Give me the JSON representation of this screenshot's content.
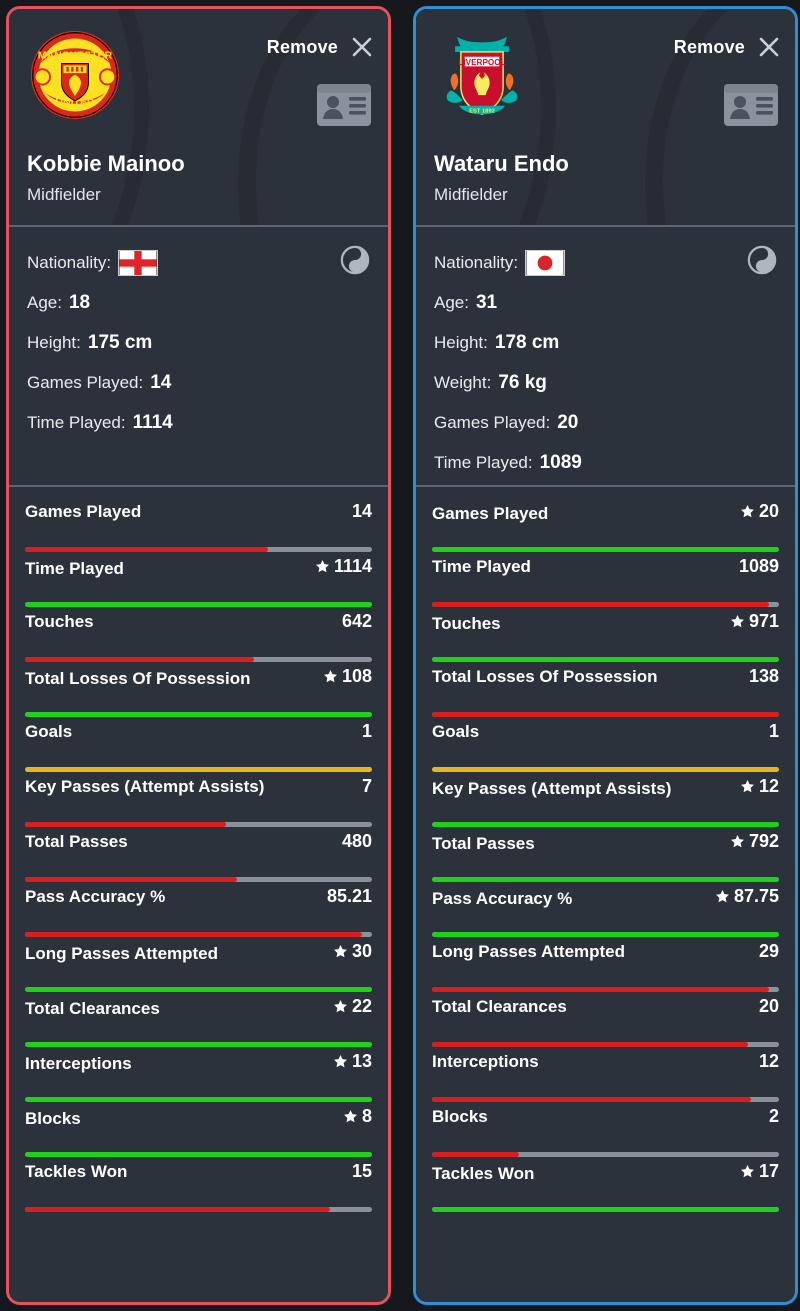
{
  "colors": {
    "accent_left": "#e8505b",
    "accent_right": "#2e8fd4",
    "bar_red": "#d81e1e",
    "bar_green": "#1fd219",
    "bar_yellow": "#e8b51c",
    "bar_track": "#8b919b",
    "card_bg": "#2c323c",
    "page_bg": "#15181d"
  },
  "cards": [
    {
      "accent": "#e8505b",
      "crest": "manchester-united-crest",
      "remove_label": "Remove",
      "close_icon": "close-icon",
      "idcard_icon": "id-card-icon",
      "name": "Kobbie Mainoo",
      "position": "Midfielder",
      "yin_icon": "yin-yang-icon",
      "info": [
        {
          "label": "Nationality:",
          "value": "",
          "flag": "england-flag"
        },
        {
          "label": "Age:",
          "value": "18"
        },
        {
          "label": "Height:",
          "value": "175 cm"
        },
        {
          "label": "Games Played:",
          "value": "14"
        },
        {
          "label": "Time Played:",
          "value": "1114"
        }
      ],
      "stats": [
        {
          "name": "Games Played",
          "value": "14",
          "star": false,
          "pct": 70,
          "color": "#d81e1e"
        },
        {
          "name": "Time Played",
          "value": "1114",
          "star": true,
          "pct": 100,
          "color": "#1fd219"
        },
        {
          "name": "Touches",
          "value": "642",
          "star": false,
          "pct": 66,
          "color": "#d81e1e"
        },
        {
          "name": "Total Losses Of Possession",
          "value": "108",
          "star": true,
          "pct": 100,
          "color": "#1fd219"
        },
        {
          "name": "Goals",
          "value": "1",
          "star": false,
          "pct": 100,
          "color": "#e8b51c"
        },
        {
          "name": "Key Passes (Attempt Assists)",
          "value": "7",
          "star": false,
          "pct": 58,
          "color": "#d81e1e"
        },
        {
          "name": "Total Passes",
          "value": "480",
          "star": false,
          "pct": 61,
          "color": "#d81e1e"
        },
        {
          "name": "Pass Accuracy %",
          "value": "85.21",
          "star": false,
          "pct": 97,
          "color": "#d81e1e"
        },
        {
          "name": "Long Passes Attempted",
          "value": "30",
          "star": true,
          "pct": 100,
          "color": "#1fd219"
        },
        {
          "name": "Total Clearances",
          "value": "22",
          "star": true,
          "pct": 100,
          "color": "#1fd219"
        },
        {
          "name": "Interceptions",
          "value": "13",
          "star": true,
          "pct": 100,
          "color": "#1fd219"
        },
        {
          "name": "Blocks",
          "value": "8",
          "star": true,
          "pct": 100,
          "color": "#1fd219"
        },
        {
          "name": "Tackles Won",
          "value": "15",
          "star": false,
          "pct": 88,
          "color": "#d81e1e"
        }
      ]
    },
    {
      "accent": "#2e8fd4",
      "crest": "liverpool-crest",
      "remove_label": "Remove",
      "close_icon": "close-icon",
      "idcard_icon": "id-card-icon",
      "name": "Wataru Endo",
      "position": "Midfielder",
      "yin_icon": "yin-yang-icon",
      "info": [
        {
          "label": "Nationality:",
          "value": "",
          "flag": "japan-flag"
        },
        {
          "label": "Age:",
          "value": "31"
        },
        {
          "label": "Height:",
          "value": "178 cm"
        },
        {
          "label": "Weight:",
          "value": "76 kg"
        },
        {
          "label": "Games Played:",
          "value": "20"
        },
        {
          "label": "Time Played:",
          "value": "1089"
        }
      ],
      "stats": [
        {
          "name": "Games Played",
          "value": "20",
          "star": true,
          "pct": 100,
          "color": "#1fd219"
        },
        {
          "name": "Time Played",
          "value": "1089",
          "star": false,
          "pct": 97,
          "color": "#d81e1e"
        },
        {
          "name": "Touches",
          "value": "971",
          "star": true,
          "pct": 100,
          "color": "#1fd219"
        },
        {
          "name": "Total Losses Of Possession",
          "value": "138",
          "star": false,
          "pct": 100,
          "color": "#d81e1e"
        },
        {
          "name": "Goals",
          "value": "1",
          "star": false,
          "pct": 100,
          "color": "#e8b51c"
        },
        {
          "name": "Key Passes (Attempt Assists)",
          "value": "12",
          "star": true,
          "pct": 100,
          "color": "#1fd219"
        },
        {
          "name": "Total Passes",
          "value": "792",
          "star": true,
          "pct": 100,
          "color": "#1fd219"
        },
        {
          "name": "Pass Accuracy %",
          "value": "87.75",
          "star": true,
          "pct": 100,
          "color": "#1fd219"
        },
        {
          "name": "Long Passes Attempted",
          "value": "29",
          "star": false,
          "pct": 97,
          "color": "#d81e1e"
        },
        {
          "name": "Total Clearances",
          "value": "20",
          "star": false,
          "pct": 91,
          "color": "#d81e1e"
        },
        {
          "name": "Interceptions",
          "value": "12",
          "star": false,
          "pct": 92,
          "color": "#d81e1e"
        },
        {
          "name": "Blocks",
          "value": "2",
          "star": false,
          "pct": 25,
          "color": "#d81e1e"
        },
        {
          "name": "Tackles Won",
          "value": "17",
          "star": true,
          "pct": 100,
          "color": "#1fd219"
        }
      ]
    }
  ]
}
